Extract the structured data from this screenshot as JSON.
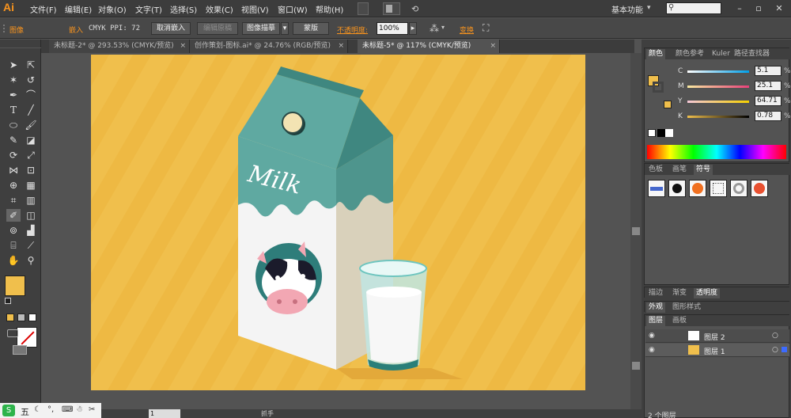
{
  "app": {
    "logo": "Ai"
  },
  "menu": [
    "文件(F)",
    "编辑(E)",
    "对象(O)",
    "文字(T)",
    "选择(S)",
    "效果(C)",
    "视图(V)",
    "窗口(W)",
    "帮助(H)"
  ],
  "workspace": "基本功能",
  "control_bar": {
    "selection_type": "图像",
    "embedded_label": "嵌入",
    "color_info": "CMYK  PPI: 72",
    "cancel_embed": "取消嵌入",
    "edit_original": "编辑原稿",
    "image_trace": "图像描摹",
    "mask": "蒙版",
    "opacity_label": "不透明度:",
    "opacity_value": "100%",
    "transform": "变换"
  },
  "tabs": [
    {
      "label": "未标题-2* @ 293.53% (CMYK/预览)"
    },
    {
      "label": "创作策划-图标.ai* @ 24.76% (RGB/预览)"
    },
    {
      "label": "未标题-5* @ 117% (CMYK/预览)"
    }
  ],
  "artwork": {
    "milk_text": "Milk"
  },
  "color_panel": {
    "tabs": [
      "颜色",
      "颜色参考",
      "Kuler",
      "路径查找器"
    ],
    "c_label": "C",
    "c_value": "5.1",
    "m_label": "M",
    "m_value": "25.1",
    "y_label": "Y",
    "y_value": "64.71",
    "k_label": "K",
    "k_value": "0.78",
    "pct": "%",
    "fill_color": "#f0bf4c"
  },
  "symbol_panel": {
    "tabs": [
      "色板",
      "画笔",
      "符号"
    ]
  },
  "stroke_panel": {
    "tabs": [
      "描边",
      "渐变",
      "透明度"
    ]
  },
  "appearance_panel": {
    "tabs": [
      "外观",
      "图形样式"
    ]
  },
  "layers_panel": {
    "tabs": [
      "图层",
      "画板"
    ],
    "layers": [
      {
        "name": "图层 2"
      },
      {
        "name": "图层 1"
      }
    ],
    "count": "2 个图层"
  },
  "status": {
    "zoom": "117%",
    "page": "1",
    "tool_hint": "抓手"
  },
  "taskbar": {
    "ime": "五"
  },
  "colors": {
    "background": "#f0bf4c",
    "carton_teal": "#5fa9a1",
    "accent_orange": "#f7931e"
  }
}
